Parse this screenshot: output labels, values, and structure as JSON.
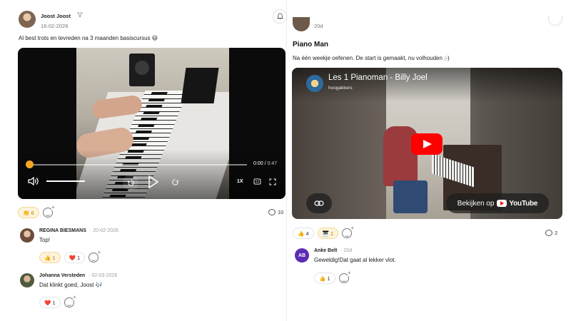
{
  "left_post": {
    "author": "Joost Joost",
    "date": "16-02-2026",
    "text": "Al best trots en tevreden na 3 maanden basiscursus 😃",
    "video": {
      "current_time": "0:00",
      "separator": "/",
      "duration": "0:47",
      "speed": "1X",
      "progress_fraction": 0.0
    },
    "reactions": [
      {
        "emoji": "👏",
        "count": "6",
        "active": true
      }
    ],
    "comment_count": "10",
    "comments": [
      {
        "name": "REGINA BIESMANS",
        "date": "20-02-2026",
        "text": "Top!",
        "reactions": [
          {
            "emoji": "👍",
            "count": "1",
            "active": true
          },
          {
            "emoji": "❤️",
            "count": "1",
            "active": false
          }
        ]
      },
      {
        "name": "Johanna Versteden",
        "date": "02-03-2026",
        "text": "Dat klinkt goed, Joost 🎶",
        "reactions": [
          {
            "emoji": "❤️",
            "count": "1",
            "active": false
          }
        ]
      }
    ]
  },
  "right_post": {
    "date": "20d",
    "title": "Piano Man",
    "text": "Na één weekje oefenen. De start is gemaakt, nu volhouden ;-)",
    "youtube": {
      "title": "Les 1 Pianoman - Billy Joel",
      "channel": "hoogakkers",
      "watch_label": "Bekijken op",
      "brand": "YouTube"
    },
    "reactions": [
      {
        "emoji": "👍",
        "count": "4",
        "active": false
      },
      {
        "emoji": "🎹",
        "count": "1",
        "active": true
      }
    ],
    "comment_count": "2",
    "comments": [
      {
        "initials": "AB",
        "name": "Anke Belt",
        "date": "20d",
        "text": "Geweldig!Dat gaat al lekker vlot.",
        "reactions": [
          {
            "emoji": "👍",
            "count": "1",
            "active": false
          }
        ]
      }
    ]
  },
  "colors": {
    "accent_orange": "#f5a623",
    "active_chip_bg": "#fff3da",
    "youtube_red": "#ff0000",
    "avatar_ab": "#5b2db3"
  },
  "icons": {
    "bell": "bell-icon",
    "trophy": "trophy-icon",
    "volume": "volume-icon",
    "rewind": "rewind-icon",
    "play": "play-icon",
    "forward": "forward-icon",
    "captions": "captions-icon",
    "fullscreen": "fullscreen-icon",
    "comment": "comment-bubble-icon",
    "add_reaction": "add-reaction-icon",
    "link": "link-icon"
  }
}
